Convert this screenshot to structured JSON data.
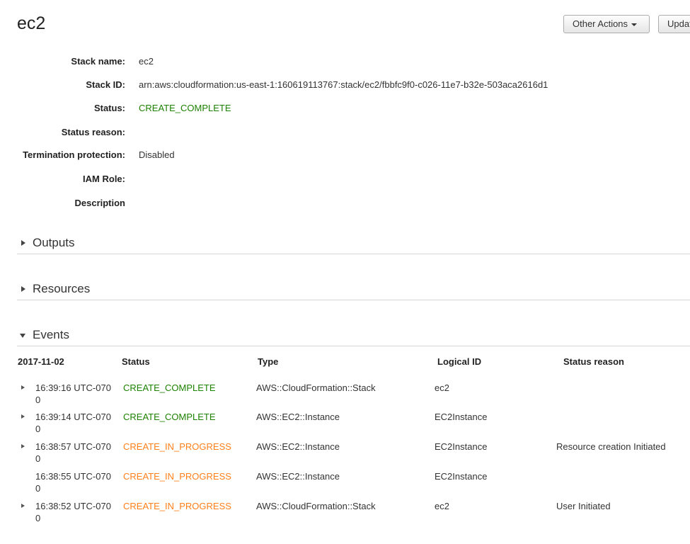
{
  "header": {
    "title": "ec2",
    "other_actions_label": "Other Actions",
    "update_label": "Update Stack"
  },
  "details": [
    {
      "label": "Stack name:",
      "value": "ec2",
      "color": "#333333"
    },
    {
      "label": "Stack ID:",
      "value": "arn:aws:cloudformation:us-east-1:160619113767:stack/ec2/fbbfc9f0-c026-11e7-b32e-503aca2616d1",
      "color": "#333333"
    },
    {
      "label": "Status:",
      "value": "CREATE_COMPLETE",
      "color": "#1d8102"
    },
    {
      "label": "Status reason:",
      "value": "",
      "color": "#333333"
    },
    {
      "label": "Termination protection:",
      "value": "Disabled",
      "color": "#333333"
    },
    {
      "label": "IAM Role:",
      "value": "",
      "color": "#333333"
    },
    {
      "label": "Description",
      "value": "",
      "color": "#333333"
    }
  ],
  "sections": {
    "outputs": "Outputs",
    "resources": "Resources",
    "events": "Events"
  },
  "events": {
    "headers": {
      "date": "2017-11-02",
      "status": "Status",
      "type": "Type",
      "logical_id": "Logical ID",
      "status_reason": "Status reason"
    },
    "rows": [
      {
        "time": "16:39:16 UTC-0700",
        "status": "CREATE_COMPLETE",
        "status_color": "#1d8102",
        "type": "AWS::CloudFormation::Stack",
        "logical_id": "ec2",
        "reason": "",
        "expandable": true
      },
      {
        "time": "16:39:14 UTC-0700",
        "status": "CREATE_COMPLETE",
        "status_color": "#1d8102",
        "type": "AWS::EC2::Instance",
        "logical_id": "EC2Instance",
        "reason": "",
        "expandable": true
      },
      {
        "time": "16:38:57 UTC-0700",
        "status": "CREATE_IN_PROGRESS",
        "status_color": "#ff7f19",
        "type": "AWS::EC2::Instance",
        "logical_id": "EC2Instance",
        "reason": "Resource creation Initiated",
        "expandable": true
      },
      {
        "time": "16:38:55 UTC-0700",
        "status": "CREATE_IN_PROGRESS",
        "status_color": "#ff7f19",
        "type": "AWS::EC2::Instance",
        "logical_id": "EC2Instance",
        "reason": "",
        "expandable": false
      },
      {
        "time": "16:38:52 UTC-0700",
        "status": "CREATE_IN_PROGRESS",
        "status_color": "#ff7f19",
        "type": "AWS::CloudFormation::Stack",
        "logical_id": "ec2",
        "reason": "User Initiated",
        "expandable": true
      }
    ]
  }
}
